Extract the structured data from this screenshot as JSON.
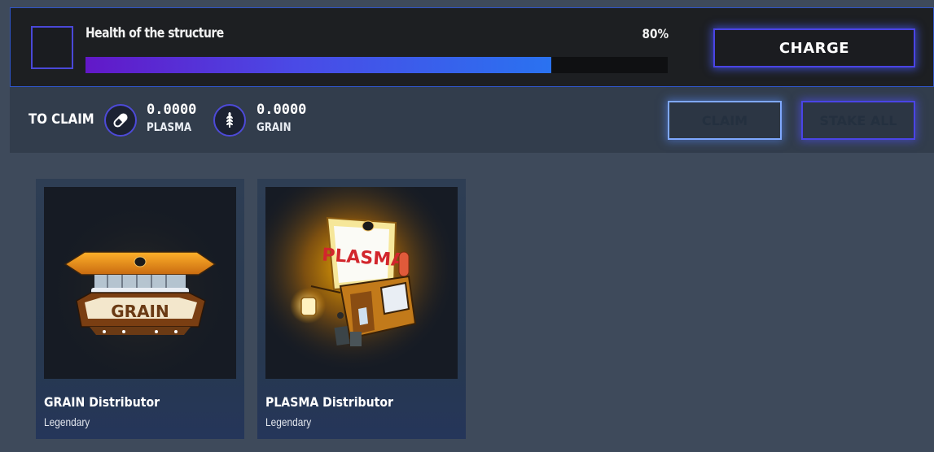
{
  "health": {
    "label": "Health of the structure",
    "percent_text": "80%",
    "percent": 0.8,
    "charge_label": "CHARGE"
  },
  "claim": {
    "label": "TO CLAIM",
    "resources": [
      {
        "value": "0.0000",
        "name": "PLASMA",
        "icon": "pill-icon"
      },
      {
        "value": "0.0000",
        "name": "GRAIN",
        "icon": "wheat-icon"
      }
    ],
    "claim_label": "CLAIM",
    "stake_all_label": "STAKE ALL"
  },
  "cards": [
    {
      "title": "GRAIN Distributor",
      "rarity": "Legendary",
      "sign_text": "GRAIN"
    },
    {
      "title": "PLASMA Distributor",
      "rarity": "Legendary",
      "sign_text": "PLASMA"
    }
  ],
  "colors": {
    "accent": "#4a44e6",
    "background": "#3e4a5b",
    "bar_start": "#6218c8",
    "bar_end": "#2a72f0"
  }
}
